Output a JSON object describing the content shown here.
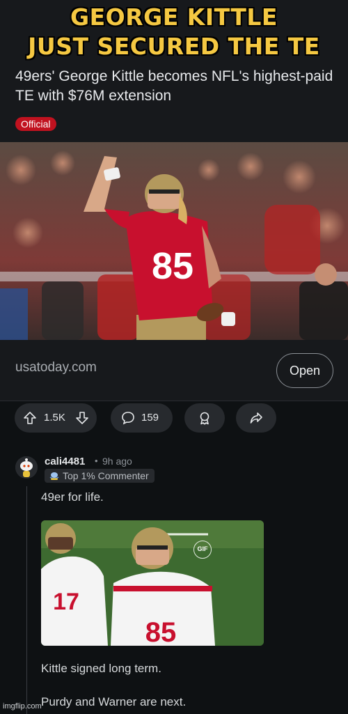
{
  "meme": {
    "caption_line_1": "GEORGE KITTLE",
    "caption_line_2": "JUST SECURED THE TE BAG"
  },
  "post": {
    "headline": "49ers' George Kittle becomes NFL's highest-paid TE with $76M extension",
    "flair": "Official",
    "link_domain": "usatoday.com",
    "open_label": "Open",
    "hero_image": {
      "jersey_number": "85",
      "photo_description_icon": "football-player-photo"
    }
  },
  "actions": {
    "upvote_icon": "arrow-up-icon",
    "vote_count": "1.5K",
    "downvote_icon": "arrow-down-icon",
    "comment_icon": "speech-bubble-icon",
    "comment_count": "159",
    "award_icon": "award-ribbon-icon",
    "share_icon": "share-arrow-icon"
  },
  "comment": {
    "username": "cali4481",
    "separator": "•",
    "age": "9h ago",
    "badge": "Top 1% Commenter",
    "line_1": "49er for life.",
    "gif_label": "GIF",
    "gif_jersey_left": "17",
    "gif_jersey_right": "85",
    "line_2": "Kittle signed long term.",
    "line_3": "Purdy and Warner are next."
  },
  "watermark": "imgflip.com",
  "colors": {
    "caption": "#f5c842",
    "background": "#0e1113",
    "card": "#17191c",
    "flair": "#c1121f",
    "pill": "#272a2e",
    "niners_red": "#aa0000",
    "niners_gold": "#b3995d"
  }
}
